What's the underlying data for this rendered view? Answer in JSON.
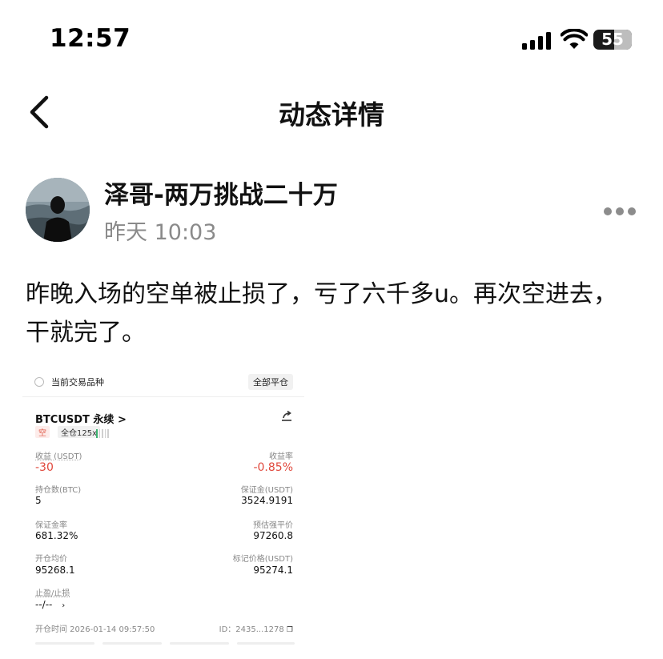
{
  "status_bar": {
    "time": "12:57",
    "battery": "55"
  },
  "nav": {
    "title": "动态详情",
    "back_icon": "chevron-left-icon"
  },
  "post": {
    "username": "泽哥-两万挑战二十万",
    "time": "昨天 10:03",
    "text": "昨晚入场的空单被止损了，亏了六千多u。再次空进去，干就完了。",
    "more_icon": "more-dots-icon"
  },
  "screenshot": {
    "header_label": "当前交易品种",
    "close_all": "全部平仓",
    "symbol": "BTCUSDT 永续 >",
    "tag_direction": "空",
    "tag_margin": "全仓125x",
    "pnl_label": "收益 (USDT)",
    "pnl_value": "-30",
    "roe_label": "收益率",
    "roe_value": "-0.85%",
    "size_label": "持仓数(BTC)",
    "size_value": "5",
    "margin_label": "保证金(USDT)",
    "margin_value": "3524.9191",
    "margin_ratio_label": "保证金率",
    "margin_ratio_value": "681.32%",
    "liq_label": "预估强平价",
    "liq_value": "97260.8",
    "entry_label": "开仓均价",
    "entry_value": "95268.1",
    "mark_label": "标记价格(USDT)",
    "mark_value": "95274.1",
    "tpsl_label": "止盈/止损",
    "tpsl_value": "--/--",
    "open_time": "开仓时间 2026-01-14 09:57:50",
    "id": "ID：2435...1278",
    "colors": {
      "loss": "#e0483c",
      "gain": "#3cb371"
    }
  }
}
